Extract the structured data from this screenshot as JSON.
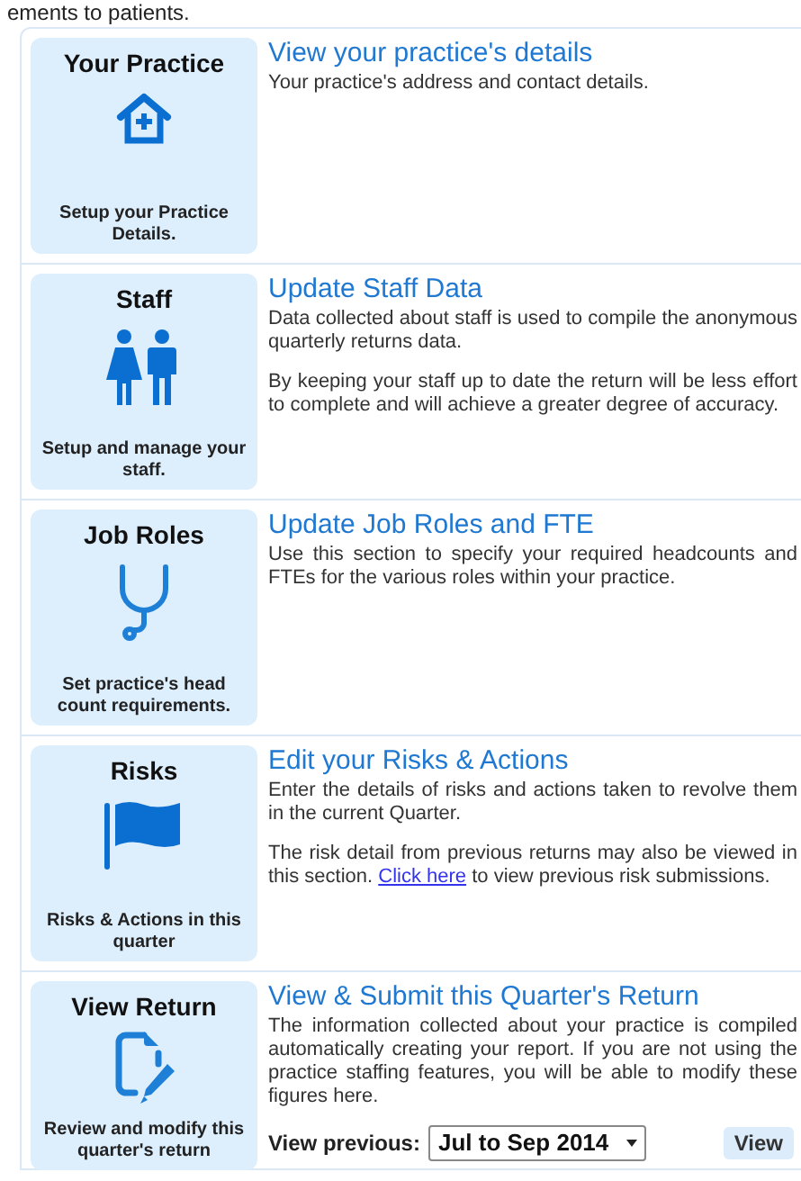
{
  "page_heading": "ements to patients.",
  "sections": [
    {
      "kind": "house",
      "tile_title": "Your Practice",
      "tile_caption": "Setup your Practice Details.",
      "heading": "View your practice's details",
      "paragraphs": [
        [
          {
            "text": "Your practice's address and contact details."
          }
        ]
      ]
    },
    {
      "kind": "people",
      "tile_title": "Staff",
      "tile_caption": "Setup and manage your staff.",
      "heading": "Update Staff Data",
      "paragraphs": [
        [
          {
            "text": "Data collected about staff is used to compile the anonymous quarterly returns data."
          }
        ],
        [
          {
            "text": "By keeping your staff up to date the return will be less effort to complete and will achieve a greater degree of accuracy."
          }
        ]
      ]
    },
    {
      "kind": "stethoscope",
      "tile_title": "Job Roles",
      "tile_caption": "Set practice's head count requirements.",
      "heading": "Update Job Roles and FTE",
      "paragraphs": [
        [
          {
            "text": "Use this section to specify your required headcounts and FTEs for the various roles within your practice."
          }
        ]
      ]
    },
    {
      "kind": "flag",
      "tile_title": "Risks",
      "tile_caption": "Risks & Actions in this quarter",
      "heading": "Edit your Risks & Actions",
      "paragraphs": [
        [
          {
            "text": "Enter the details of risks and actions taken to revolve them in the current Quarter."
          }
        ],
        [
          {
            "text": "The risk detail from previous returns may also be viewed in this section. "
          },
          {
            "link": "Click here"
          },
          {
            "text": " to view previous risk submissions."
          }
        ]
      ]
    },
    {
      "kind": "document",
      "tile_title": "View Return",
      "tile_caption": "Review and modify this quarter's return",
      "heading": "View & Submit this Quarter's Return",
      "paragraphs": [
        [
          {
            "text": "The information collected about your practice is compiled automatically creating your report. If you are not using the practice staffing features, you will be able to modify these figures here."
          }
        ]
      ],
      "controls": {
        "label": "View previous:",
        "select_value": "Jul to Sep 2014",
        "button": "View"
      }
    }
  ]
}
